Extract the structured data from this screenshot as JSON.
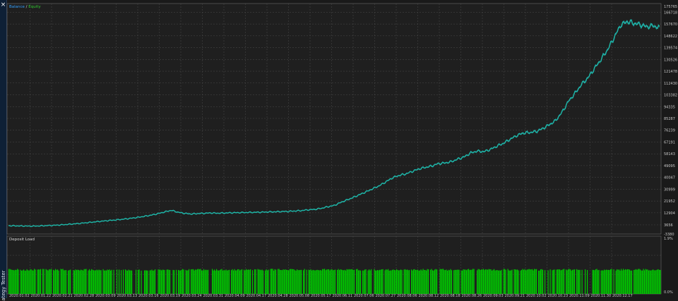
{
  "side_panel": {
    "close_glyph": "×",
    "label": "ategy Tester"
  },
  "chart_data": [
    {
      "type": "line",
      "title_parts": [
        {
          "text": "Balance",
          "color": "#33a1ff"
        },
        {
          "text": " / ",
          "color": "#d8d8d8"
        },
        {
          "text": "Equity",
          "color": "#33cc33"
        }
      ],
      "ylim": [
        -3380,
        173400
      ],
      "yticks": [
        -3380,
        3656,
        12904,
        21952,
        30999,
        40047,
        49095,
        58143,
        67191,
        76239,
        85287,
        94335,
        103382,
        112430,
        121478,
        130526,
        139574,
        148622,
        157670,
        166718,
        175765
      ],
      "xticks": [
        "2020.01.02",
        "2020.01.22",
        "2020.02.21",
        "2020.02.28",
        "2020.03.09",
        "2020.03.13",
        "2020.03.16",
        "2020.03.19",
        "2020.03.24",
        "2020.03.31",
        "2020.04.09",
        "2020.04.17",
        "2020.04.28",
        "2020.05.08",
        "2020.05.17",
        "2020.06.11",
        "2020.07.06",
        "2020.07.27",
        "2020.08.06",
        "2020.08.12",
        "2020.08.18",
        "2020.08.26",
        "2020.09.03",
        "2020.09.21",
        "2020.10.02",
        "2020.10.23",
        "2020.11.09",
        "2020.11.30",
        "2020.12.17"
      ],
      "grid": true,
      "series": [
        {
          "name": "Balance",
          "color": "#1fa3ad",
          "x": [
            0,
            1,
            2,
            3,
            4,
            5,
            6,
            7,
            8,
            9,
            10,
            11,
            12,
            13,
            14,
            15,
            16,
            17,
            18,
            19,
            20,
            21,
            22,
            23,
            24,
            25,
            26,
            27,
            28,
            29,
            30,
            31,
            32,
            33,
            34,
            35,
            36,
            37,
            38,
            39,
            40,
            41,
            42,
            43,
            44,
            45,
            46,
            47,
            48,
            49,
            50,
            51,
            52,
            53,
            54,
            55,
            56,
            57,
            58,
            59,
            60,
            61,
            62,
            63,
            64,
            65,
            66,
            67,
            68,
            69,
            70,
            71,
            72,
            73,
            74,
            75,
            76,
            77,
            78,
            79,
            80,
            81,
            82,
            83,
            84,
            85,
            86,
            87,
            88,
            89,
            90,
            91,
            92,
            93,
            94,
            95,
            96,
            97,
            98,
            99,
            100
          ],
          "values": [
            3000,
            2900,
            2800,
            2700,
            2700,
            2900,
            3100,
            3300,
            3600,
            4000,
            4400,
            4800,
            5300,
            5800,
            6300,
            6800,
            7200,
            7700,
            8200,
            8800,
            9500,
            10300,
            11200,
            12300,
            13600,
            14800,
            13400,
            12500,
            12000,
            12300,
            12500,
            12800,
            12600,
            12700,
            12900,
            13000,
            13100,
            13200,
            13300,
            13400,
            13600,
            13700,
            13900,
            14000,
            14300,
            14600,
            15200,
            15500,
            16300,
            17500,
            18500,
            20800,
            22800,
            24800,
            27000,
            29200,
            31500,
            33800,
            36800,
            39800,
            41600,
            42700,
            44600,
            46500,
            47700,
            48800,
            50600,
            51100,
            52100,
            54100,
            55800,
            58900,
            60200,
            59800,
            61500,
            64000,
            66200,
            69200,
            72000,
            74000,
            74500,
            75200,
            77400,
            80300,
            83500,
            90000,
            98400,
            104600,
            111300,
            116500,
            123700,
            130600,
            138000,
            147200,
            156800,
            159600,
            158300,
            157200,
            155600,
            156400,
            154600
          ]
        },
        {
          "name": "Equity",
          "color": "#1fc7a0",
          "x": [
            0,
            1,
            2,
            3,
            4,
            5,
            6,
            7,
            8,
            9,
            10,
            11,
            12,
            13,
            14,
            15,
            16,
            17,
            18,
            19,
            20,
            21,
            22,
            23,
            24,
            25,
            26,
            27,
            28,
            29,
            30,
            31,
            32,
            33,
            34,
            35,
            36,
            37,
            38,
            39,
            40,
            41,
            42,
            43,
            44,
            45,
            46,
            47,
            48,
            49,
            50,
            51,
            52,
            53,
            54,
            55,
            56,
            57,
            58,
            59,
            60,
            61,
            62,
            63,
            64,
            65,
            66,
            67,
            68,
            69,
            70,
            71,
            72,
            73,
            74,
            75,
            76,
            77,
            78,
            79,
            80,
            81,
            82,
            83,
            84,
            85,
            86,
            87,
            88,
            89,
            90,
            91,
            92,
            93,
            94,
            95,
            96,
            97,
            98,
            99,
            100
          ],
          "values": [
            3000,
            2900,
            2800,
            2700,
            2700,
            2900,
            3100,
            3300,
            3600,
            4000,
            4400,
            4800,
            5300,
            5800,
            6300,
            6800,
            7200,
            7700,
            8200,
            8800,
            9500,
            10300,
            11200,
            12300,
            13600,
            14800,
            13400,
            12500,
            12000,
            12300,
            12500,
            12800,
            12600,
            12700,
            12900,
            13000,
            13100,
            13200,
            13300,
            13400,
            13600,
            13700,
            13900,
            14000,
            14300,
            14600,
            15200,
            15500,
            16300,
            17500,
            18500,
            20800,
            22800,
            24800,
            27000,
            29200,
            31500,
            33800,
            36800,
            39800,
            41600,
            42700,
            44600,
            46500,
            47700,
            48800,
            50600,
            51100,
            52100,
            54100,
            55800,
            58900,
            60200,
            59800,
            61500,
            64000,
            66200,
            69200,
            72000,
            74000,
            74500,
            75200,
            77400,
            80300,
            83500,
            90000,
            98400,
            104600,
            111300,
            116500,
            123700,
            130600,
            138000,
            147200,
            156800,
            159600,
            158300,
            157200,
            155600,
            156400,
            154600
          ]
        }
      ]
    },
    {
      "type": "bar",
      "title": "Deposit Load",
      "ylim": [
        0,
        1.9
      ],
      "yticks": [
        "1.9%",
        "0.0%"
      ],
      "bar_color": "#00c800",
      "typical_value": 0.8
    }
  ]
}
